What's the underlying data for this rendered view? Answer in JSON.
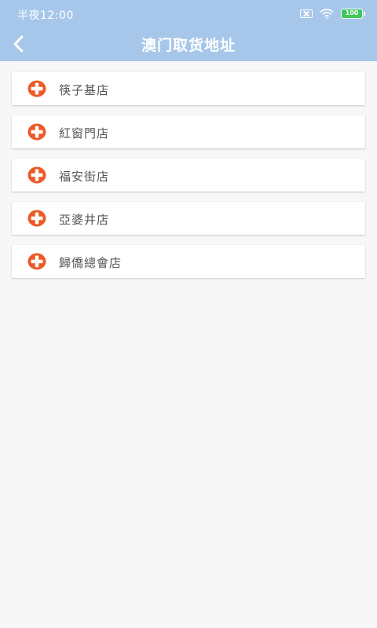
{
  "status_bar": {
    "time": "半夜12:00",
    "battery": "100",
    "battery_color": "#3fc75a"
  },
  "header": {
    "title": "澳门取货地址",
    "back_icon": "chevron-left-icon",
    "background": "#a6c7ea"
  },
  "stores": [
    {
      "name": "筷子基店",
      "icon": "add-circle-icon"
    },
    {
      "name": "紅窗門店",
      "icon": "add-circle-icon"
    },
    {
      "name": "福安街店",
      "icon": "add-circle-icon"
    },
    {
      "name": "亞婆井店",
      "icon": "add-circle-icon"
    },
    {
      "name": "歸僑總會店",
      "icon": "add-circle-icon"
    }
  ],
  "colors": {
    "accent": "#ec5a26",
    "page_background": "#f7f7f7"
  }
}
